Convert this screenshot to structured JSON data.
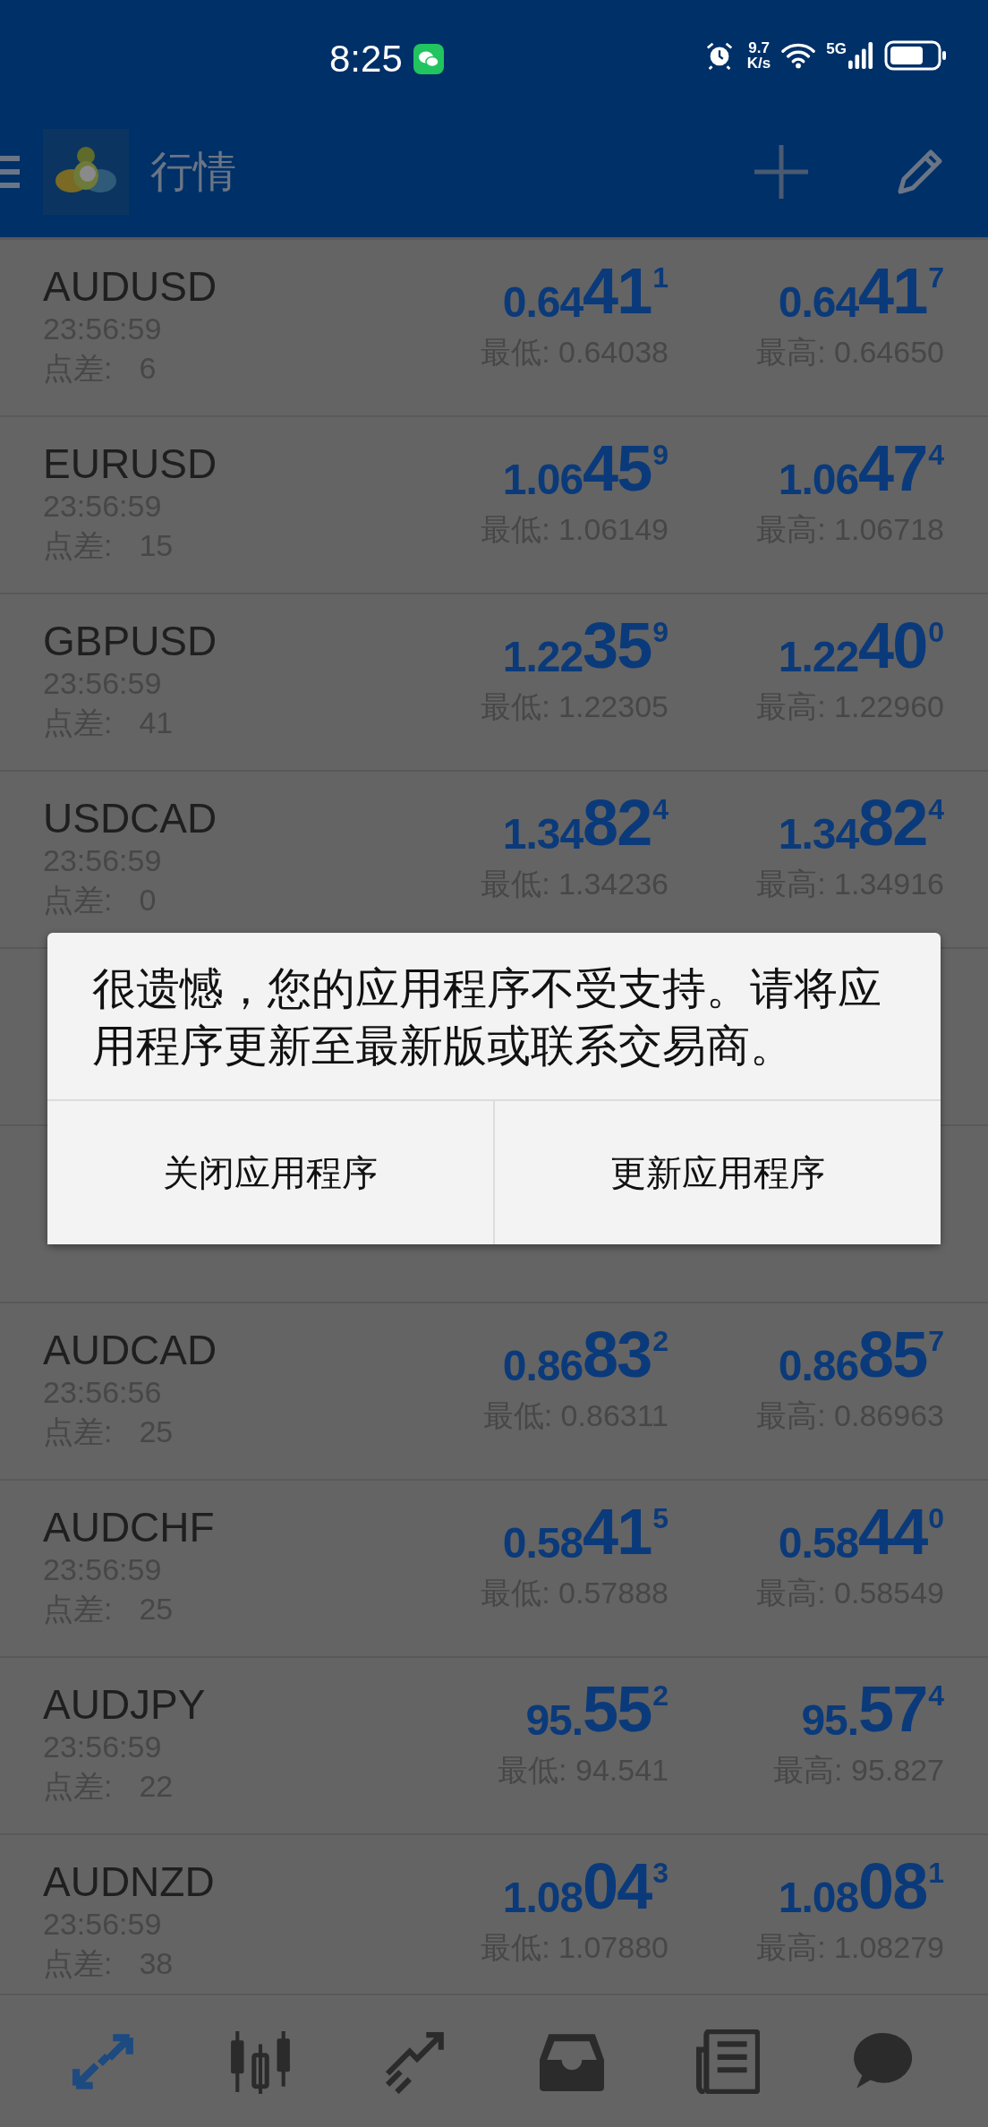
{
  "status_bar": {
    "time": "8:25",
    "net_speed": "9.7",
    "net_unit": "K/s",
    "network": "5G"
  },
  "header": {
    "title": "行情"
  },
  "quotes": [
    {
      "symbol": "AUDUSD",
      "time": "23:56:59",
      "spread_label": "点差:",
      "spread": "6",
      "bid": {
        "prefix": "0.64",
        "big": "41",
        "sup": "1"
      },
      "ask": {
        "prefix": "0.64",
        "big": "41",
        "sup": "7"
      },
      "low": "最低: 0.64038",
      "high": "最高: 0.64650"
    },
    {
      "symbol": "EURUSD",
      "time": "23:56:59",
      "spread_label": "点差:",
      "spread": "15",
      "bid": {
        "prefix": "1.06",
        "big": "45",
        "sup": "9"
      },
      "ask": {
        "prefix": "1.06",
        "big": "47",
        "sup": "4"
      },
      "low": "最低: 1.06149",
      "high": "最高: 1.06718"
    },
    {
      "symbol": "GBPUSD",
      "time": "23:56:59",
      "spread_label": "点差:",
      "spread": "41",
      "bid": {
        "prefix": "1.22",
        "big": "35",
        "sup": "9"
      },
      "ask": {
        "prefix": "1.22",
        "big": "40",
        "sup": "0"
      },
      "low": "最低: 1.22305",
      "high": "最高: 1.22960"
    },
    {
      "symbol": "USDCAD",
      "time": "23:56:59",
      "spread_label": "点差:",
      "spread": "0",
      "bid": {
        "prefix": "1.34",
        "big": "82",
        "sup": "4"
      },
      "ask": {
        "prefix": "1.34",
        "big": "82",
        "sup": "4"
      },
      "low": "最低: 1.34236",
      "high": "最高: 1.34916"
    }
  ],
  "quotes_below": [
    {
      "symbol": "AUDCAD",
      "time": "23:56:56",
      "spread_label": "点差:",
      "spread": "25",
      "bid": {
        "prefix": "0.86",
        "big": "83",
        "sup": "2"
      },
      "ask": {
        "prefix": "0.86",
        "big": "85",
        "sup": "7"
      },
      "low": "最低: 0.86311",
      "high": "最高: 0.86963"
    },
    {
      "symbol": "AUDCHF",
      "time": "23:56:59",
      "spread_label": "点差:",
      "spread": "25",
      "bid": {
        "prefix": "0.58",
        "big": "41",
        "sup": "5"
      },
      "ask": {
        "prefix": "0.58",
        "big": "44",
        "sup": "0"
      },
      "low": "最低: 0.57888",
      "high": "最高: 0.58549"
    },
    {
      "symbol": "AUDJPY",
      "time": "23:56:59",
      "spread_label": "点差:",
      "spread": "22",
      "bid": {
        "prefix": "95.",
        "big": "55",
        "sup": "2"
      },
      "ask": {
        "prefix": "95.",
        "big": "57",
        "sup": "4"
      },
      "low": "最低: 94.541",
      "high": "最高: 95.827"
    },
    {
      "symbol": "AUDNZD",
      "time": "23:56:59",
      "spread_label": "点差:",
      "spread": "38",
      "bid": {
        "prefix": "1.08",
        "big": "04",
        "sup": "3"
      },
      "ask": {
        "prefix": "1.08",
        "big": "08",
        "sup": "1"
      },
      "low": "最低: 1.07880",
      "high": "最高: 1.08279"
    }
  ],
  "dialog": {
    "message": "很遗憾，您的应用程序不受支持。请将应用程序更新至最新版或联系交易商。",
    "buttons": [
      "关闭应用程序",
      "更新应用程序"
    ]
  },
  "bottom_nav": [
    {
      "kind": "quotes",
      "selected": true
    },
    {
      "kind": "chart",
      "selected": false
    },
    {
      "kind": "trade",
      "selected": false
    },
    {
      "kind": "inbox",
      "selected": false
    },
    {
      "kind": "news",
      "selected": false
    },
    {
      "kind": "chat",
      "selected": false
    }
  ]
}
